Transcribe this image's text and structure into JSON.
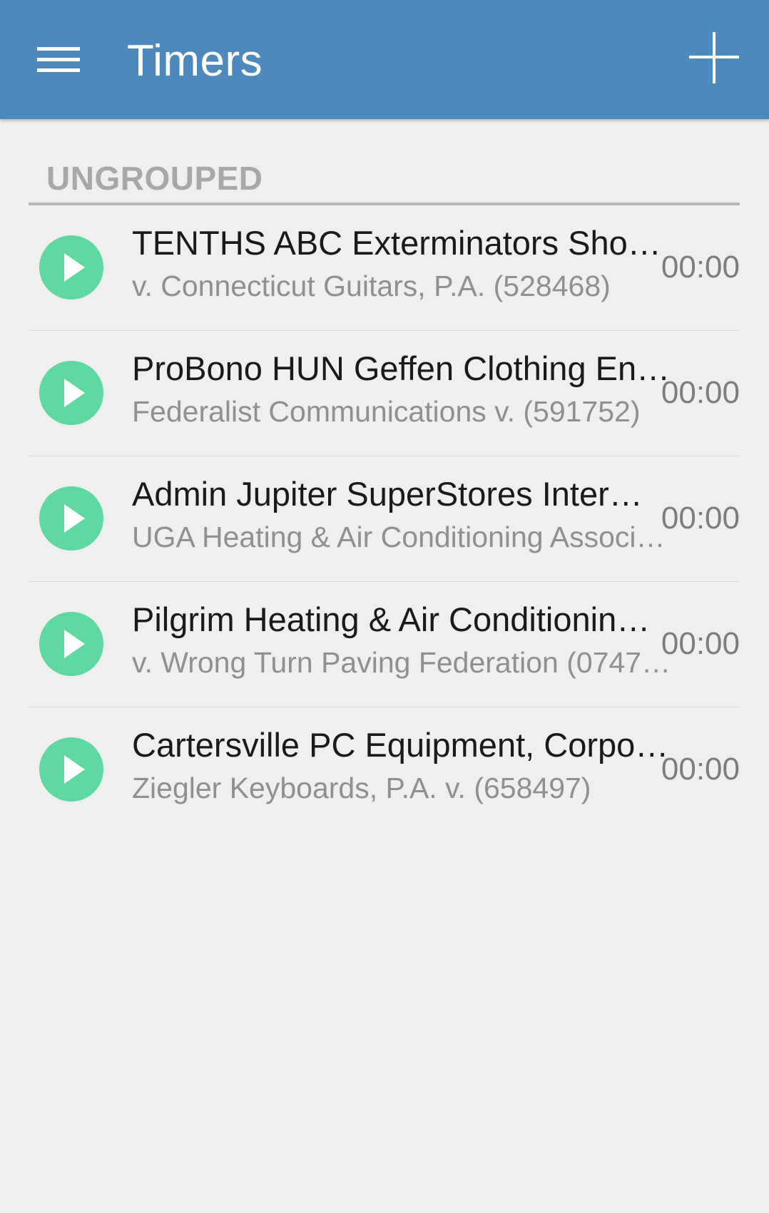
{
  "app_bar": {
    "title": "Timers",
    "menu_icon": "hamburger-menu-icon",
    "add_icon": "plus-icon",
    "background": "#4e89bd"
  },
  "group": {
    "label": "UNGROUPED"
  },
  "timers": [
    {
      "title": "TENTHS ABC Exterminators Sho…",
      "subtitle": "v. Connecticut Guitars, P.A. (528468)",
      "time": "00:00"
    },
    {
      "title": "ProBono HUN Geffen Clothing En…",
      "subtitle": "Federalist Communications  v. (591752)",
      "time": "00:00"
    },
    {
      "title": "Admin Jupiter SuperStores Inter…",
      "subtitle": "UGA Heating & Air Conditioning Associ…",
      "time": "00:00"
    },
    {
      "title": "Pilgrim Heating & Air Conditionin…",
      "subtitle": "v. Wrong Turn Paving Federation (0747…",
      "time": "00:00"
    },
    {
      "title": "Cartersville PC Equipment, Corpo…",
      "subtitle": "Ziegler Keyboards, P.A. v. (658497)",
      "time": "00:00"
    }
  ],
  "colors": {
    "accent": "#5fd7a0",
    "background": "#efefef"
  }
}
